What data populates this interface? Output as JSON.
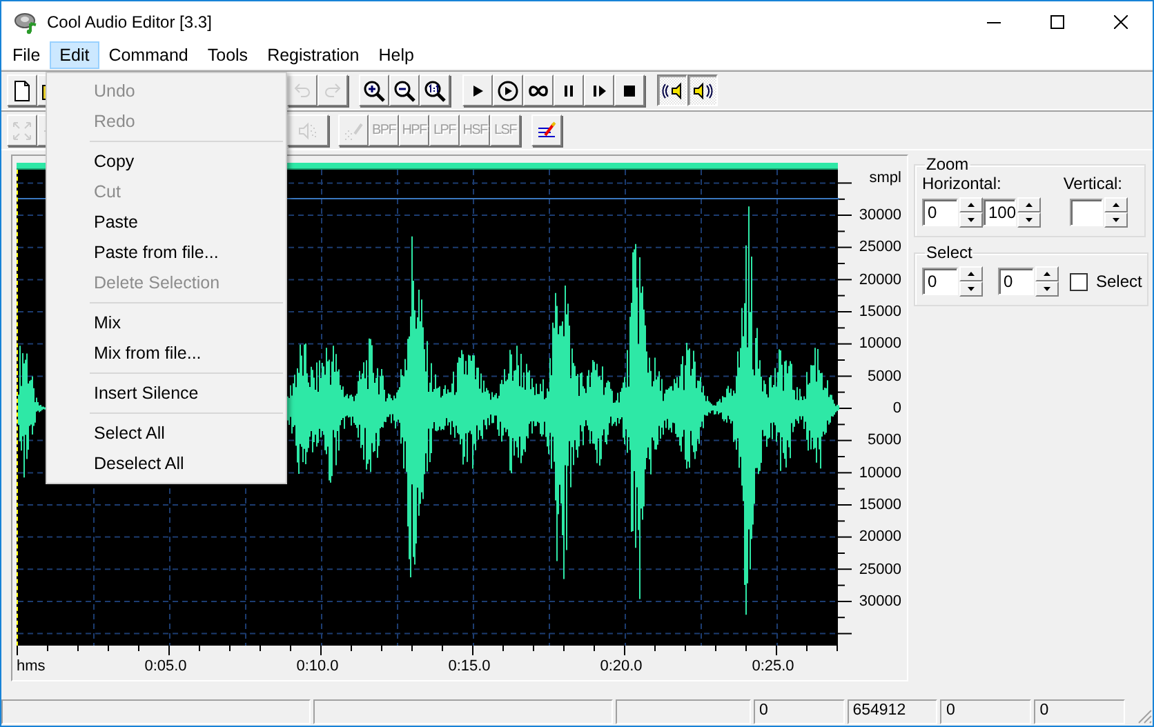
{
  "window": {
    "title": "Cool Audio Editor [3.3]"
  },
  "menu_bar": [
    {
      "label": "File",
      "selected": false
    },
    {
      "label": "Edit",
      "selected": true
    },
    {
      "label": "Command",
      "selected": false
    },
    {
      "label": "Tools",
      "selected": false
    },
    {
      "label": "Registration",
      "selected": false
    },
    {
      "label": "Help",
      "selected": false
    }
  ],
  "edit_menu": [
    {
      "kind": "item",
      "label": "Undo",
      "disabled": true
    },
    {
      "kind": "item",
      "label": "Redo",
      "disabled": true
    },
    {
      "kind": "separator"
    },
    {
      "kind": "item",
      "label": "Copy",
      "disabled": false
    },
    {
      "kind": "item",
      "label": "Cut",
      "disabled": true
    },
    {
      "kind": "item",
      "label": "Paste",
      "disabled": false
    },
    {
      "kind": "item",
      "label": "Paste from file...",
      "disabled": false
    },
    {
      "kind": "item",
      "label": "Delete Selection",
      "disabled": true
    },
    {
      "kind": "separator"
    },
    {
      "kind": "item",
      "label": "Mix",
      "disabled": false
    },
    {
      "kind": "item",
      "label": "Mix from file...",
      "disabled": false
    },
    {
      "kind": "separator"
    },
    {
      "kind": "item",
      "label": "Insert Silence",
      "disabled": false
    },
    {
      "kind": "separator"
    },
    {
      "kind": "item",
      "label": "Select All",
      "disabled": false
    },
    {
      "kind": "item",
      "label": "Deselect All",
      "disabled": false
    }
  ],
  "toolbar_1": [
    [
      {
        "kind": "new",
        "disabled": false,
        "pressed": false
      },
      {
        "kind": "open",
        "disabled": false,
        "pressed": false
      }
    ],
    [
      {
        "kind": "undo",
        "disabled": true,
        "pressed": false
      },
      {
        "kind": "redo",
        "disabled": true,
        "pressed": false
      }
    ],
    [
      {
        "kind": "zoomin",
        "disabled": false,
        "pressed": false
      },
      {
        "kind": "zoomout",
        "disabled": false,
        "pressed": false
      },
      {
        "kind": "zoomfull",
        "disabled": false,
        "pressed": false
      }
    ],
    [
      {
        "kind": "play",
        "disabled": false,
        "pressed": false
      },
      {
        "kind": "playcircle",
        "disabled": false,
        "pressed": false
      },
      {
        "kind": "loop",
        "disabled": false,
        "pressed": false
      },
      {
        "kind": "pause",
        "disabled": false,
        "pressed": false
      },
      {
        "kind": "step",
        "disabled": false,
        "pressed": false
      },
      {
        "kind": "stop",
        "disabled": false,
        "pressed": false
      }
    ],
    [
      {
        "kind": "speakerleft",
        "disabled": false,
        "pressed": true
      },
      {
        "kind": "speakerright",
        "disabled": false,
        "pressed": true
      }
    ]
  ],
  "toolbar_2": [
    [
      {
        "kind": "fit",
        "disabled": true,
        "pressed": false
      },
      {
        "kind": "minus",
        "disabled": true,
        "pressed": false
      }
    ],
    [
      {
        "kind": "noise",
        "disabled": true,
        "pressed": false
      }
    ],
    [
      {
        "kind": "sparkle",
        "disabled": true,
        "pressed": false
      },
      {
        "kind": "text",
        "label": "BPF",
        "disabled": true,
        "pressed": false
      },
      {
        "kind": "text",
        "label": "HPF",
        "disabled": true,
        "pressed": false
      },
      {
        "kind": "text",
        "label": "LPF",
        "disabled": true,
        "pressed": false
      },
      {
        "kind": "text",
        "label": "HSF",
        "disabled": true,
        "pressed": false
      },
      {
        "kind": "text",
        "label": "LSF",
        "disabled": true,
        "pressed": false
      }
    ],
    [
      {
        "kind": "pen",
        "disabled": false,
        "pressed": false
      }
    ]
  ],
  "waveform": {
    "amplitude_unit": "smpl",
    "amplitude_labels": [
      "30000",
      "25000",
      "20000",
      "15000",
      "10000",
      "5000",
      "0",
      "5000",
      "10000",
      "15000",
      "20000",
      "25000",
      "30000"
    ],
    "time_unit": "hms",
    "time_labels": [
      "0:05.0",
      "0:10.0",
      "0:15.0",
      "0:20.0",
      "0:25.0"
    ]
  },
  "zoom": {
    "title": "Zoom",
    "horizontal_label": "Horizontal:",
    "horizontal_from": "0",
    "horizontal_to": "100",
    "vertical_label": "Vertical:"
  },
  "select": {
    "title": "Select",
    "from": "0",
    "to": "0",
    "checkbox": {
      "label": "Select",
      "checked": false
    }
  },
  "status_bar": [
    "0",
    "654912",
    "0",
    "0"
  ]
}
